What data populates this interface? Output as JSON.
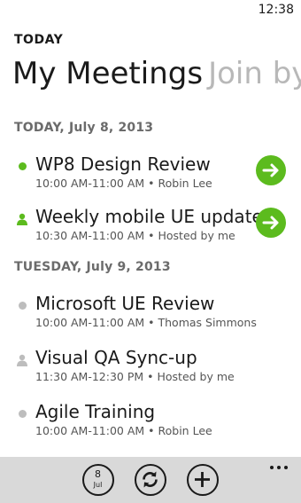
{
  "status_bar": {
    "time": "12:38"
  },
  "app": {
    "title": "TODAY"
  },
  "pivot": {
    "active": "My Meetings",
    "inactive": "Join by"
  },
  "sections": [
    {
      "header": "TODAY, July 8, 2013",
      "meetings": [
        {
          "title": "WP8 Design Review",
          "subtitle": "10:00 AM-11:00 AM • Robin Lee",
          "icon": "green-dot-icon",
          "has_join": true
        },
        {
          "title": "Weekly mobile UE update",
          "subtitle": "10:30 AM-11:00 AM • Hosted by me",
          "icon": "green-person-icon",
          "has_join": true
        }
      ]
    },
    {
      "header": "TUESDAY, July 9, 2013",
      "meetings": [
        {
          "title": "Microsoft UE Review",
          "subtitle": "10:00 AM-11:00 AM • Thomas Simmons",
          "icon": "gray-dot-icon",
          "has_join": false
        },
        {
          "title": "Visual QA Sync-up",
          "subtitle": "11:30 AM-12:30 PM • Hosted by me",
          "icon": "gray-person-icon",
          "has_join": false
        },
        {
          "title": "Agile Training",
          "subtitle": "10:00 AM-11:00 AM • Robin Lee",
          "icon": "gray-dot-icon",
          "has_join": false
        }
      ]
    }
  ],
  "app_bar": {
    "calendar_day": "8",
    "calendar_month": "Jul",
    "buttons": [
      "calendar-icon",
      "sync-icon",
      "add-icon",
      "more-icon"
    ]
  },
  "colors": {
    "accent": "#5cbb1e",
    "inactive_dot": "#bdbdbd",
    "app_bar": "#d9d9d9",
    "section_header": "#6b6b6b"
  }
}
